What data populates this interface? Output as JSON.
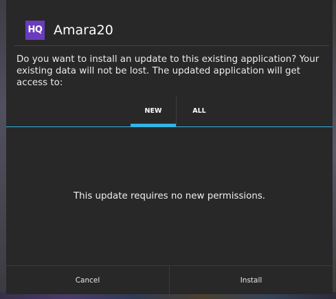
{
  "dialog": {
    "app_icon_text": "HQ",
    "app_icon_color": "#6a3bbd",
    "app_title": "Amara20",
    "message": "Do you want to install an update to this existing application? Your existing data will not be lost. The updated application will get access to:"
  },
  "tabs": [
    {
      "label": "NEW",
      "selected": true
    },
    {
      "label": "ALL",
      "selected": false
    }
  ],
  "accent_color": "#33b5e5",
  "content": {
    "permissions_text": "This update requires no new permissions."
  },
  "buttons": {
    "cancel_label": "Cancel",
    "install_label": "Install"
  }
}
